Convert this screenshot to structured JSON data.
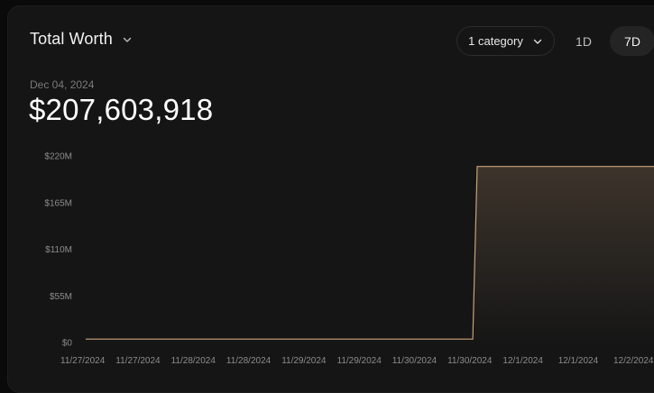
{
  "header": {
    "title": "Total Worth"
  },
  "controls": {
    "category_label": "1 category",
    "ranges": [
      "1D",
      "7D"
    ],
    "selected_range": "7D"
  },
  "summary": {
    "date": "Dec 04, 2024",
    "value": "$207,603,918"
  },
  "icons": {
    "title_chevron": "chevron-down-icon",
    "category_chevron": "chevron-down-icon"
  },
  "colors": {
    "line": "#c8a278",
    "area_top": "#3d342b",
    "area_bottom": "#161616"
  },
  "chart_data": {
    "type": "area",
    "y_ticks": [
      "$220M",
      "$165M",
      "$110M",
      "$55M",
      "$0"
    ],
    "y_tick_values": [
      220,
      165,
      110,
      55,
      0
    ],
    "ylim": [
      0,
      220
    ],
    "y_unit": "$M",
    "x_ticks": [
      "11/27/2024",
      "11/27/2024",
      "11/28/2024",
      "11/28/2024",
      "11/29/2024",
      "11/29/2024",
      "11/30/2024",
      "11/30/2024",
      "12/1/2024",
      "12/1/2024",
      "12/2/2024"
    ],
    "series": [
      {
        "x": [
          0,
          1,
          2,
          3,
          4,
          5,
          6,
          7,
          7.08,
          8,
          9,
          10,
          10.8
        ],
        "values": [
          4,
          4,
          4,
          4,
          4,
          4,
          4,
          4,
          207.6,
          207.6,
          207.6,
          207.6,
          207.6
        ]
      }
    ],
    "grid": false,
    "legend": "none"
  }
}
